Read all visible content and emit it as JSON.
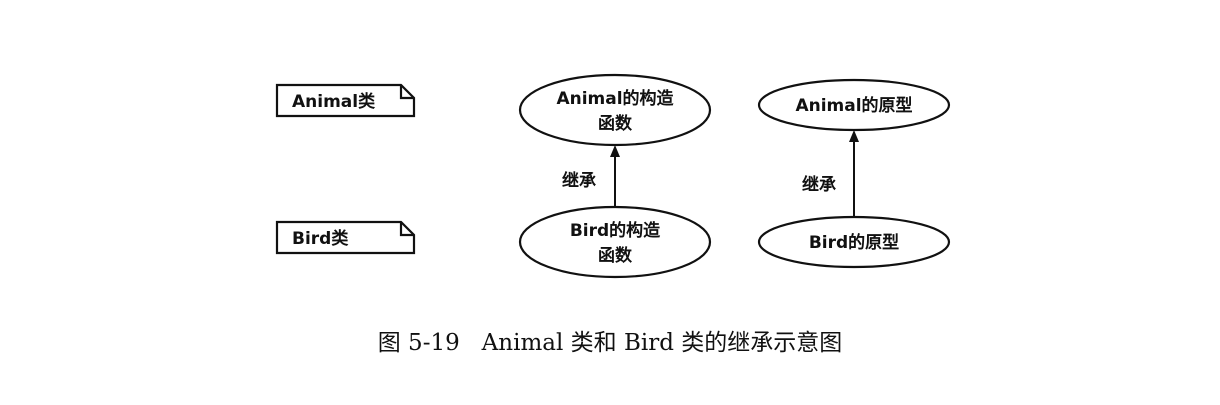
{
  "classes": {
    "animal": {
      "label": "Animal类"
    },
    "bird": {
      "label": "Bird类"
    }
  },
  "nodes": {
    "animal_constructor": {
      "line1": "Animal的构造",
      "line2": "函数"
    },
    "animal_prototype": {
      "label": "Animal的原型"
    },
    "bird_constructor": {
      "line1": "Bird的构造",
      "line2": "函数"
    },
    "bird_prototype": {
      "label": "Bird的原型"
    }
  },
  "edges": {
    "constructor_inherit": {
      "label": "继承"
    },
    "prototype_inherit": {
      "label": "继承"
    }
  },
  "caption": {
    "text": "图 5-19   Animal 类和 Bird 类的继承示意图"
  }
}
